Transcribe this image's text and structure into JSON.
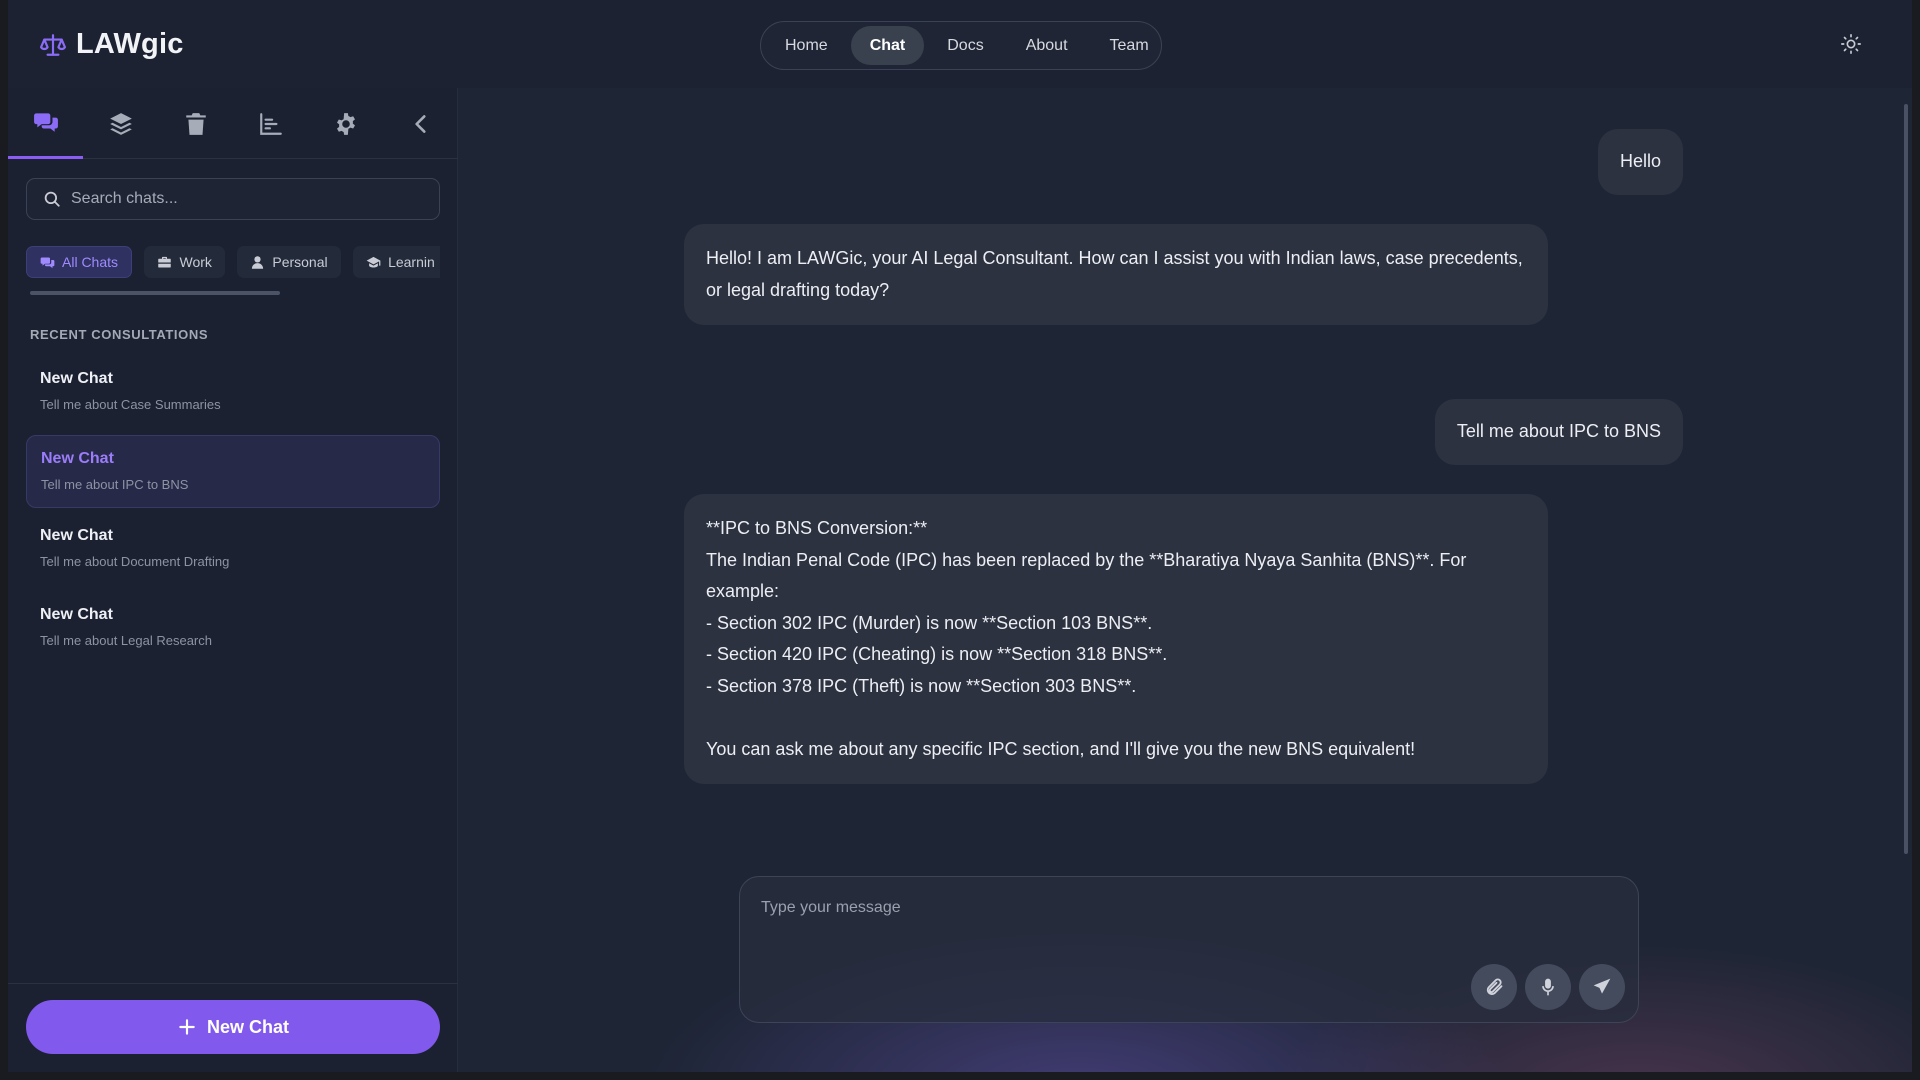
{
  "app": {
    "name": "LAWgic",
    "logo_icon": "scales-icon"
  },
  "nav": {
    "items": [
      {
        "label": "Home",
        "active": false
      },
      {
        "label": "Chat",
        "active": true
      },
      {
        "label": "Docs",
        "active": false
      },
      {
        "label": "About",
        "active": false
      },
      {
        "label": "Team",
        "active": false
      }
    ],
    "theme_icon": "sun-icon"
  },
  "sidebar": {
    "tabs": [
      {
        "icon": "chats-icon",
        "active": true
      },
      {
        "icon": "layers-icon",
        "active": false
      },
      {
        "icon": "trash-icon",
        "active": false
      },
      {
        "icon": "chart-icon",
        "active": false
      },
      {
        "icon": "gear-icon",
        "active": false
      },
      {
        "icon": "chevron-left-icon",
        "active": false
      }
    ],
    "search_placeholder": "Search chats...",
    "filters": [
      {
        "label": "All Chats",
        "icon": "chats-icon",
        "active": true
      },
      {
        "label": "Work",
        "icon": "briefcase-icon",
        "active": false
      },
      {
        "label": "Personal",
        "icon": "user-icon",
        "active": false
      },
      {
        "label": "Learnin",
        "icon": "graduation-cap-icon",
        "active": false
      }
    ],
    "section_title": "RECENT CONSULTATIONS",
    "chats": [
      {
        "title": "New Chat",
        "subtitle": "Tell me about Case Summaries",
        "active": false
      },
      {
        "title": "New Chat",
        "subtitle": "Tell me about IPC to BNS",
        "active": true
      },
      {
        "title": "New Chat",
        "subtitle": "Tell me about Document Drafting",
        "active": false
      },
      {
        "title": "New Chat",
        "subtitle": "Tell me about Legal Research",
        "active": false
      }
    ],
    "new_chat_label": "New Chat"
  },
  "messages": [
    {
      "role": "user",
      "text": "Hello"
    },
    {
      "role": "assistant",
      "text": "Hello! I am LAWGic, your AI Legal Consultant. How can I assist you with Indian laws, case precedents, or legal drafting today?"
    },
    {
      "role": "user",
      "text": "Tell me about IPC to BNS"
    },
    {
      "role": "assistant",
      "text": "**IPC to BNS Conversion:**\nThe Indian Penal Code (IPC) has been replaced by the **Bharatiya Nyaya Sanhita (BNS)**. For example:\n- Section 302 IPC (Murder) is now **Section 103 BNS**.\n- Section 420 IPC (Cheating) is now **Section 318 BNS**.\n- Section 378 IPC (Theft) is now **Section 303 BNS**.\n\nYou can ask me about any specific IPC section, and I'll give you the new BNS equivalent!"
    }
  ],
  "composer": {
    "placeholder": "Type your message",
    "buttons": [
      "paperclip-icon",
      "microphone-icon",
      "send-icon"
    ]
  },
  "colors": {
    "accent": "#8159ec",
    "background": "#1e2535",
    "bubble": "#2c3240"
  }
}
